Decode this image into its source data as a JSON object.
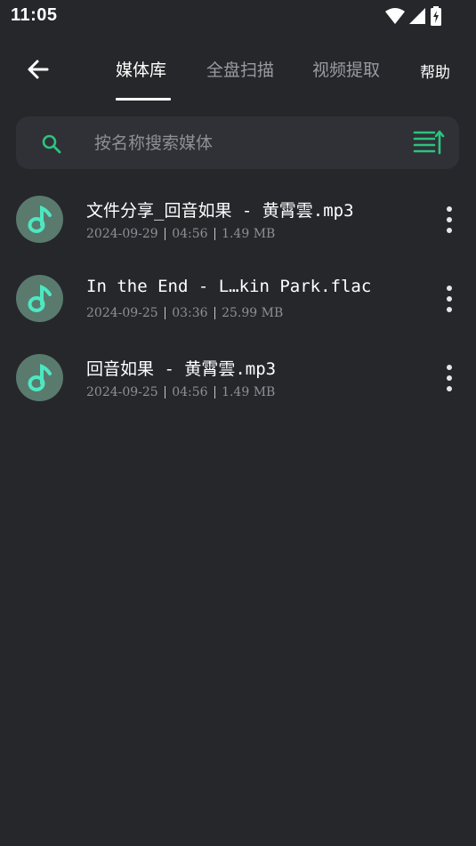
{
  "status_bar": {
    "time": "11:05",
    "icons": [
      "wifi-icon",
      "signal-icon",
      "battery-charging-icon"
    ]
  },
  "app_bar": {
    "back_icon": "arrow-left-icon",
    "tabs": [
      {
        "label": "媒体库",
        "active": true
      },
      {
        "label": "全盘扫描",
        "active": false
      },
      {
        "label": "视频提取",
        "active": false
      }
    ],
    "help_label": "帮助"
  },
  "search": {
    "icon": "search-icon",
    "placeholder": "按名称搜索媒体",
    "value": "",
    "sort_icon": "sort-icon"
  },
  "colors": {
    "background": "#26272b",
    "search_bg": "#2f3136",
    "accent_green": "#2ec27e",
    "avatar_bg": "#5a7a6e",
    "note_teal": "#4de8c2"
  },
  "media_items": [
    {
      "title": "文件分享_回音如果 - 黄霄雲.mp3",
      "date": "2024-09-29",
      "duration": "04:56",
      "size": "1.49 MB",
      "icon": "music-note-icon"
    },
    {
      "title": "In the End - L…kin Park.flac",
      "date": "2024-09-25",
      "duration": "03:36",
      "size": "25.99 MB",
      "icon": "music-note-icon"
    },
    {
      "title": "回音如果 - 黄霄雲.mp3",
      "date": "2024-09-25",
      "duration": "04:56",
      "size": "1.49 MB",
      "icon": "music-note-icon"
    }
  ]
}
